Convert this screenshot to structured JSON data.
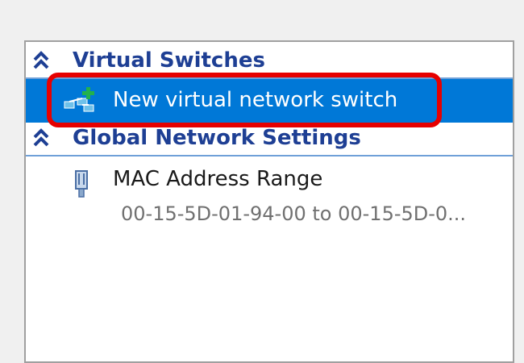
{
  "tree": {
    "virtual_switches": {
      "title": "Virtual Switches",
      "items": [
        {
          "label": "New virtual network switch",
          "selected": true
        }
      ]
    },
    "global_network_settings": {
      "title": "Global Network Settings",
      "items": [
        {
          "label": "MAC Address Range",
          "detail": "00-15-5D-01-94-00 to 00-15-5D-0..."
        }
      ]
    }
  },
  "colors": {
    "selection": "#0078d7",
    "section_title": "#1e3f94",
    "highlight_ring": "#e60000"
  }
}
